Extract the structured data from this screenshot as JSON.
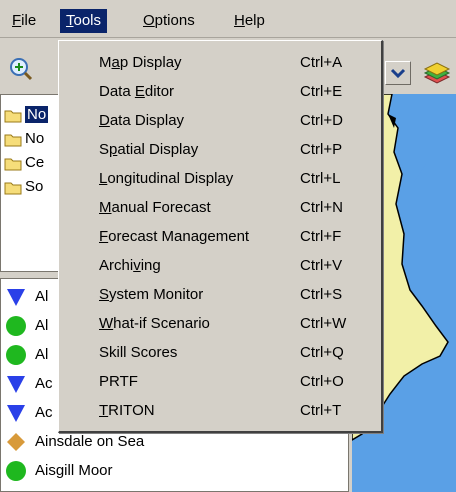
{
  "menubar": {
    "file": {
      "pre": "",
      "key": "F",
      "post": "ile"
    },
    "tools": {
      "pre": "",
      "key": "T",
      "post": "ools"
    },
    "options": {
      "pre": "",
      "key": "O",
      "post": "ptions"
    },
    "help": {
      "pre": "",
      "key": "H",
      "post": "elp"
    }
  },
  "tools_menu": {
    "items": [
      {
        "pre": "M",
        "key": "a",
        "post": "p Display",
        "shortcut": "Ctrl+A"
      },
      {
        "pre": "Data ",
        "key": "E",
        "post": "ditor",
        "shortcut": "Ctrl+E"
      },
      {
        "pre": "",
        "key": "D",
        "post": "ata Display",
        "shortcut": "Ctrl+D"
      },
      {
        "pre": "S",
        "key": "p",
        "post": "atial Display",
        "shortcut": "Ctrl+P"
      },
      {
        "pre": "",
        "key": "L",
        "post": "ongitudinal Display",
        "shortcut": "Ctrl+L"
      },
      {
        "pre": "",
        "key": "M",
        "post": "anual Forecast",
        "shortcut": "Ctrl+N"
      },
      {
        "pre": "",
        "key": "F",
        "post": "orecast Management",
        "shortcut": "Ctrl+F"
      },
      {
        "pre": "Archi",
        "key": "v",
        "post": "ing",
        "shortcut": "Ctrl+V"
      },
      {
        "pre": "",
        "key": "S",
        "post": "ystem Monitor",
        "shortcut": "Ctrl+S"
      },
      {
        "pre": "",
        "key": "W",
        "post": "hat-if Scenario",
        "shortcut": "Ctrl+W"
      },
      {
        "pre": "Skill Scores",
        "key": "",
        "post": "",
        "shortcut": "Ctrl+Q"
      },
      {
        "pre": "PRTF",
        "key": "",
        "post": "",
        "shortcut": "Ctrl+O"
      },
      {
        "pre": "",
        "key": "T",
        "post": "RITON",
        "shortcut": "Ctrl+T"
      }
    ]
  },
  "tree": {
    "items": [
      {
        "label": "No"
      },
      {
        "label": "No"
      },
      {
        "label": "Ce"
      },
      {
        "label": "So"
      }
    ]
  },
  "stations": {
    "items": [
      {
        "label": "Al",
        "symbol": "blue-triangle"
      },
      {
        "label": "Al",
        "symbol": "green-circle"
      },
      {
        "label": "Al",
        "symbol": "green-circle"
      },
      {
        "label": "Ac",
        "symbol": "blue-triangle"
      },
      {
        "label": "Ac",
        "symbol": "blue-triangle"
      },
      {
        "label": "Ainsdale on Sea",
        "symbol": "orange-diamond"
      },
      {
        "label": "Aisgill Moor",
        "symbol": "green-circle"
      }
    ]
  },
  "colors": {
    "menu_highlight": "#0a246a",
    "sea": "#5aa0e6",
    "land": "#f2f0a8",
    "blue_triangle": "#2a40e8",
    "green_circle": "#1fb81f",
    "orange_diamond": "#d89a3a"
  }
}
